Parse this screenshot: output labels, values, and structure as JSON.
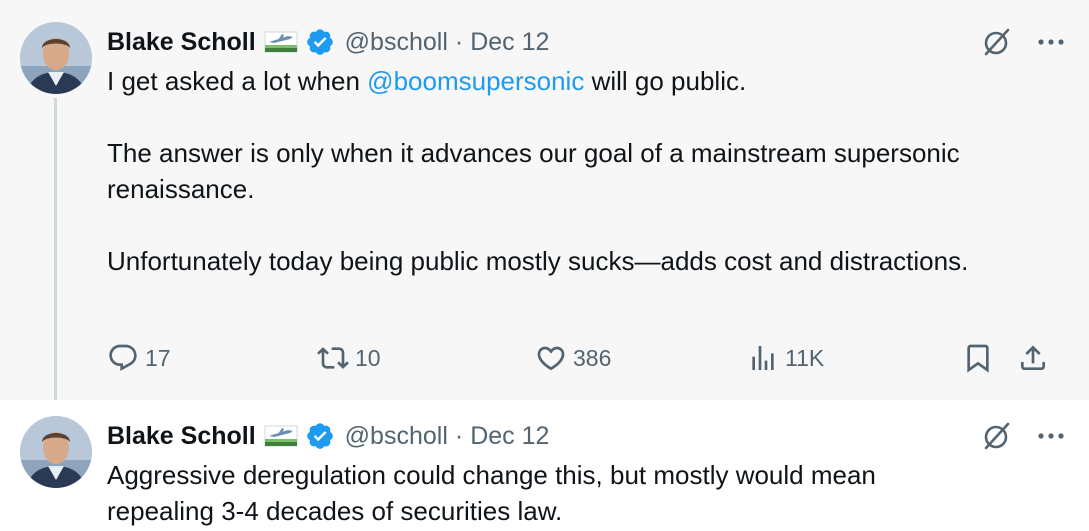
{
  "tweets": [
    {
      "author_name": "Blake Scholl",
      "handle": "@bscholl",
      "separator": "·",
      "date": "Dec 12",
      "text_parts": {
        "p1_before": "I get asked a lot when ",
        "p1_mention": "@boomsupersonic",
        "p1_after": " will go public.",
        "p2": "The answer is only when it advances our goal of a mainstream supersonic renaissance.",
        "p3": "Unfortunately today being public mostly sucks—adds cost and distractions."
      },
      "stats": {
        "replies": "17",
        "reposts": "10",
        "likes": "386",
        "views": "11K"
      }
    },
    {
      "author_name": "Blake Scholl",
      "handle": "@bscholl",
      "separator": "·",
      "date": "Dec 12",
      "text": "Aggressive deregulation could change this, but mostly would mean repealing 3-4 decades of securities law."
    }
  ],
  "colors": {
    "accent": "#1d9bf0",
    "muted": "#536471",
    "text": "#0f1419",
    "highlight_bg": "#f7f7f7"
  },
  "icons": {
    "verified": "verified-badge-icon",
    "flag": "airplane-flag-icon",
    "grok": "grok-icon",
    "more": "more-icon",
    "reply": "reply-icon",
    "repost": "repost-icon",
    "like": "like-icon",
    "views": "views-icon",
    "bookmark": "bookmark-icon",
    "share": "share-icon"
  }
}
